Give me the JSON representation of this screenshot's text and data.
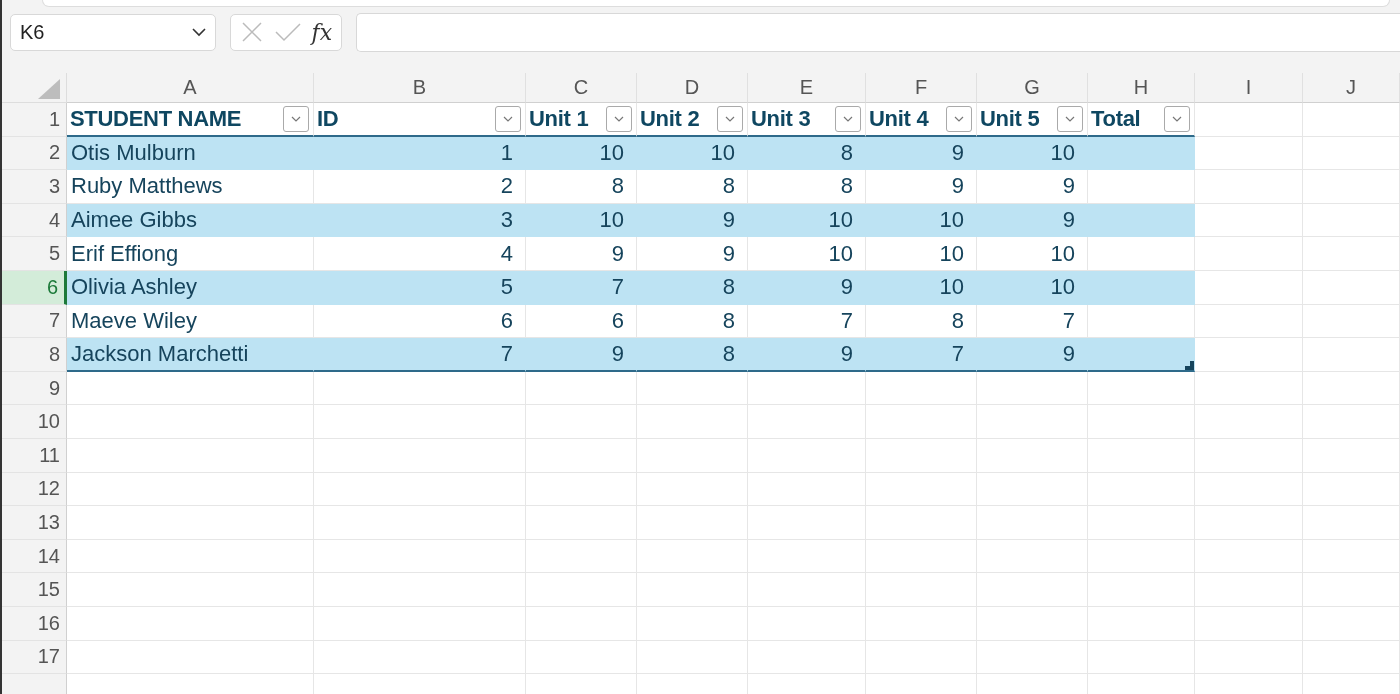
{
  "name_box": {
    "value": "K6"
  },
  "formula_bar": {
    "function_label": "fx"
  },
  "columns": [
    {
      "letter": "A",
      "selected": false
    },
    {
      "letter": "B",
      "selected": false
    },
    {
      "letter": "C",
      "selected": false
    },
    {
      "letter": "D",
      "selected": false
    },
    {
      "letter": "E",
      "selected": false
    },
    {
      "letter": "F",
      "selected": false
    },
    {
      "letter": "G",
      "selected": false
    },
    {
      "letter": "H",
      "selected": false
    },
    {
      "letter": "I",
      "selected": false
    },
    {
      "letter": "J",
      "selected": false
    }
  ],
  "row_headers": [
    {
      "label": "1",
      "selected": false
    },
    {
      "label": "2",
      "selected": false
    },
    {
      "label": "3",
      "selected": false
    },
    {
      "label": "4",
      "selected": false
    },
    {
      "label": "5",
      "selected": false
    },
    {
      "label": "6",
      "selected": true
    },
    {
      "label": "7",
      "selected": false
    },
    {
      "label": "8",
      "selected": false
    },
    {
      "label": "9",
      "selected": false
    },
    {
      "label": "10",
      "selected": false
    },
    {
      "label": "11",
      "selected": false
    },
    {
      "label": "12",
      "selected": false
    },
    {
      "label": "13",
      "selected": false
    },
    {
      "label": "14",
      "selected": false
    },
    {
      "label": "15",
      "selected": false
    },
    {
      "label": "16",
      "selected": false
    },
    {
      "label": "17",
      "selected": false
    }
  ],
  "table": {
    "headers": [
      {
        "label": "STUDENT NAME"
      },
      {
        "label": "ID"
      },
      {
        "label": "Unit 1"
      },
      {
        "label": "Unit 2"
      },
      {
        "label": "Unit 3"
      },
      {
        "label": "Unit 4"
      },
      {
        "label": "Unit 5"
      },
      {
        "label": "Total"
      }
    ],
    "rows": [
      {
        "banded": true,
        "cells": [
          "Otis Mulburn",
          "1",
          "10",
          "10",
          "8",
          "9",
          "10"
        ]
      },
      {
        "banded": false,
        "cells": [
          "Ruby Matthews",
          "2",
          "8",
          "8",
          "8",
          "9",
          "9"
        ]
      },
      {
        "banded": true,
        "cells": [
          "Aimee Gibbs",
          "3",
          "10",
          "9",
          "10",
          "10",
          "9"
        ]
      },
      {
        "banded": false,
        "cells": [
          "Erif Effiong",
          "4",
          "9",
          "9",
          "10",
          "10",
          "10"
        ]
      },
      {
        "banded": true,
        "cells": [
          "Olivia Ashley",
          "5",
          "7",
          "8",
          "9",
          "10",
          "10"
        ]
      },
      {
        "banded": false,
        "cells": [
          "Maeve Wiley",
          "6",
          "6",
          "8",
          "7",
          "8",
          "7"
        ]
      },
      {
        "banded": true,
        "cells": [
          "Jackson Marchetti",
          "7",
          "9",
          "8",
          "9",
          "7",
          "9"
        ]
      }
    ]
  }
}
